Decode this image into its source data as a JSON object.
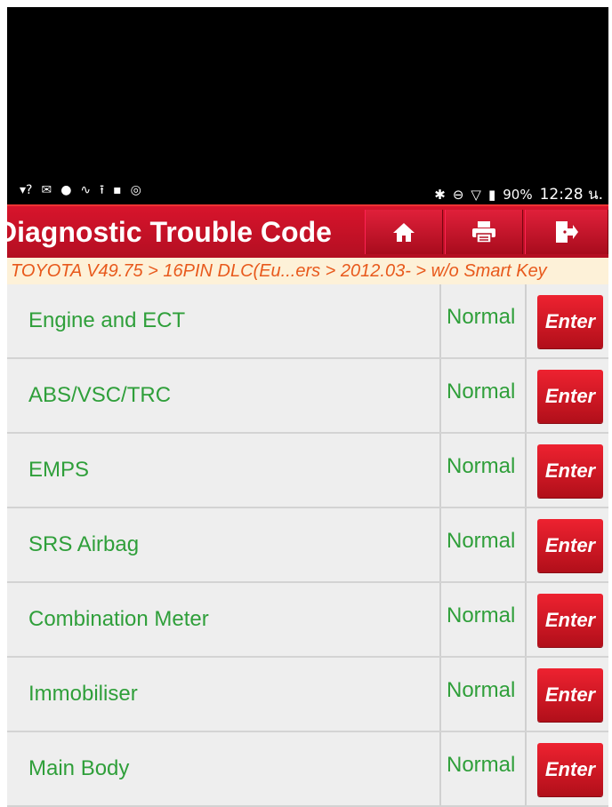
{
  "status_bar": {
    "left_icons": [
      "wifi-question-icon",
      "mail-icon",
      "chat-icon",
      "stethoscope-icon",
      "upload-icon",
      "image-icon",
      "bluetooth-circle-icon"
    ],
    "right_icons": [
      "bluetooth-icon",
      "dnd-icon",
      "signal-icon",
      "battery-icon"
    ],
    "battery": "90%",
    "time": "12:28 น."
  },
  "header": {
    "title": "Diagnostic Trouble Code",
    "buttons": [
      "home-icon",
      "print-icon",
      "exit-icon"
    ]
  },
  "breadcrumb": "TOYOTA V49.75 > 16PIN DLC(Eu...ers > 2012.03- > w/o Smart Key",
  "systems": [
    {
      "name": "Engine and ECT",
      "status": "Normal",
      "action": "Enter"
    },
    {
      "name": "ABS/VSC/TRC",
      "status": "Normal",
      "action": "Enter"
    },
    {
      "name": "EMPS",
      "status": "Normal",
      "action": "Enter"
    },
    {
      "name": "SRS Airbag",
      "status": "Normal",
      "action": "Enter"
    },
    {
      "name": "Combination Meter",
      "status": "Normal",
      "action": "Enter"
    },
    {
      "name": "Immobiliser",
      "status": "Normal",
      "action": "Enter"
    },
    {
      "name": "Main Body",
      "status": "Normal",
      "action": "Enter"
    }
  ],
  "colors": {
    "header_red": "#c8112a",
    "system_green": "#2f9f3a",
    "breadcrumb_orange": "#e8591c",
    "breadcrumb_bg": "#fdf1d8"
  }
}
